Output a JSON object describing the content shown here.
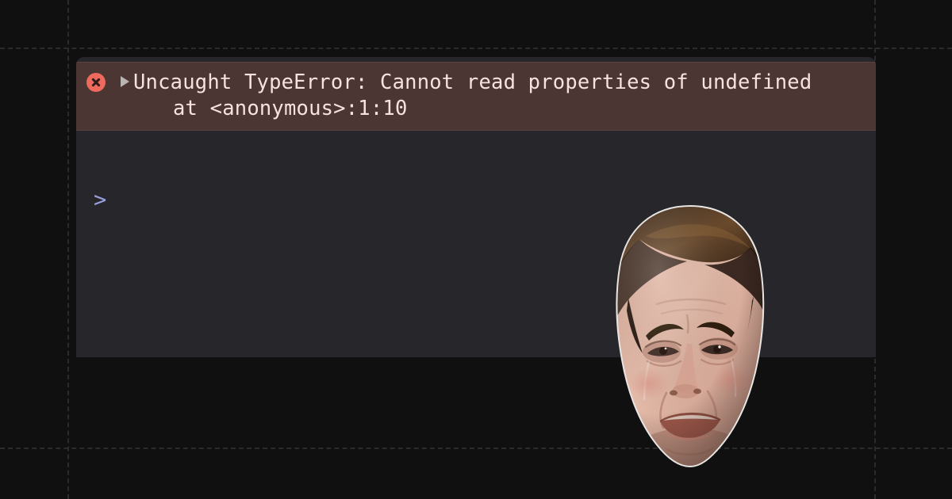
{
  "page": {
    "background_color": "#101011",
    "grid_line_color": "#2b2b2b"
  },
  "console": {
    "background_color": "#26262b",
    "entries": [
      {
        "type": "error",
        "icon": "error-circle-x-icon",
        "expandable": true,
        "disclosure_state": "collapsed",
        "message": "Uncaught TypeError: Cannot read properties of undefined",
        "stack_line": "at <anonymous>:1:10",
        "background_color": "#4b3634",
        "text_color": "#f6e2df",
        "icon_color": "#ef6a5d"
      }
    ],
    "prompt": {
      "chevron": ">",
      "chevron_color": "#9aa0e0",
      "value": "",
      "placeholder": ""
    }
  },
  "overlay": {
    "sticker": {
      "name": "crying-tobey-maguire-face",
      "alt": "Crying man face meme cutout"
    }
  }
}
